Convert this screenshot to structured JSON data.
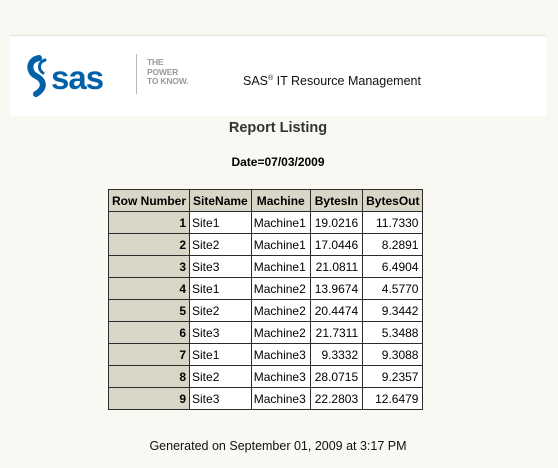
{
  "header": {
    "logo_text": "sas",
    "tagline": [
      "THE",
      "POWER",
      "TO KNOW."
    ],
    "product_name_prefix": "SAS",
    "product_registered_mark": "®",
    "product_name_suffix": " IT Resource Management"
  },
  "report": {
    "title": "Report Listing",
    "date_line": "Date=07/03/2009",
    "columns": [
      "Row Number",
      "SiteName",
      "Machine",
      "BytesIn",
      "BytesOut"
    ],
    "rows": [
      [
        "1",
        "Site1",
        "Machine1",
        "19.0216",
        "11.7330"
      ],
      [
        "2",
        "Site2",
        "Machine1",
        "17.0446",
        "8.2891"
      ],
      [
        "3",
        "Site3",
        "Machine1",
        "21.0811",
        "6.4904"
      ],
      [
        "4",
        "Site1",
        "Machine2",
        "13.9674",
        "4.5770"
      ],
      [
        "5",
        "Site2",
        "Machine2",
        "20.4474",
        "9.3442"
      ],
      [
        "6",
        "Site3",
        "Machine2",
        "21.7311",
        "5.3488"
      ],
      [
        "7",
        "Site1",
        "Machine3",
        "9.3332",
        "9.3088"
      ],
      [
        "8",
        "Site2",
        "Machine3",
        "28.0715",
        "9.2357"
      ],
      [
        "9",
        "Site3",
        "Machine3",
        "22.2803",
        "12.6479"
      ]
    ]
  },
  "footer": {
    "generated": "Generated on September 01, 2009 at 3:17 PM"
  },
  "colors": {
    "page_background": "#faf8f3",
    "header_cell_background": "#d8d6c6",
    "logo_blue": "#0061a8"
  },
  "icons": {
    "logo": "sas-swirl-logo"
  }
}
